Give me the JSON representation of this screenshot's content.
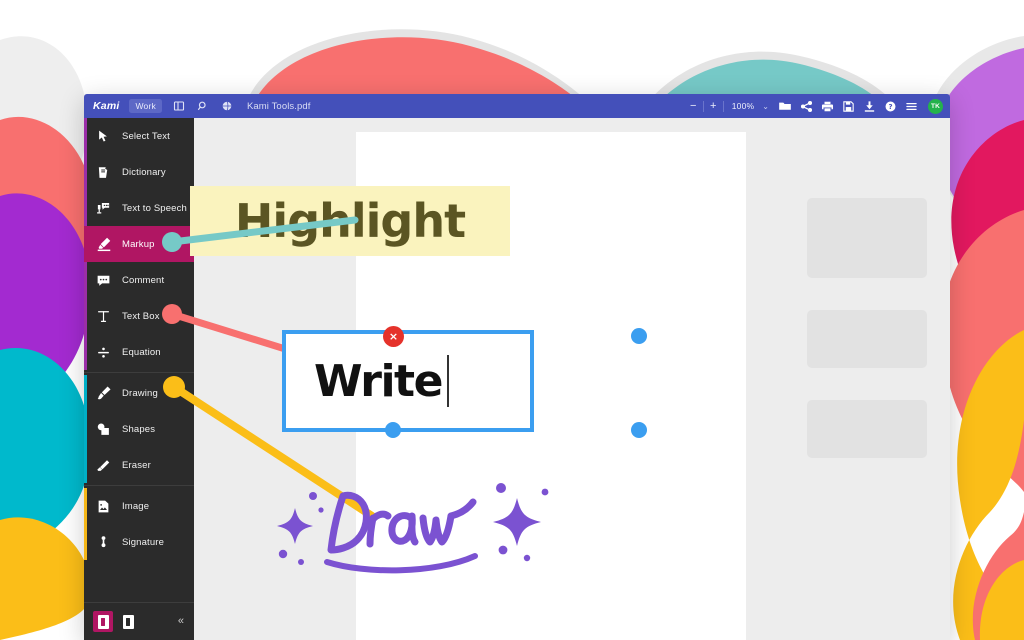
{
  "window": {
    "brand": "Kami",
    "work_badge": "Work",
    "document_title": "Kami Tools.pdf",
    "zoom_level": "100%",
    "zoom_out": "−",
    "zoom_in": "+",
    "avatar_initials": "TK"
  },
  "titlebar_icons": [
    {
      "name": "split-view-icon",
      "label": "Split View"
    },
    {
      "name": "search-icon",
      "label": "Search"
    },
    {
      "name": "globe-icon",
      "label": "Translate"
    }
  ],
  "titlebar_right_icons": [
    {
      "name": "open-folder-icon",
      "label": "Open"
    },
    {
      "name": "share-icon",
      "label": "Share"
    },
    {
      "name": "print-icon",
      "label": "Print"
    },
    {
      "name": "save-icon",
      "label": "Save"
    },
    {
      "name": "download-icon",
      "label": "Download"
    },
    {
      "name": "help-icon",
      "label": "Help"
    },
    {
      "name": "menu-icon",
      "label": "Menu"
    }
  ],
  "sidebar": {
    "groups": [
      {
        "accent": "#9b2ea8",
        "items": [
          {
            "label": "Select Text",
            "icon": "cursor-arrow-icon",
            "active": false
          },
          {
            "label": "Dictionary",
            "icon": "book-icon",
            "active": false
          },
          {
            "label": "Text to Speech",
            "icon": "speech-icon",
            "active": false
          },
          {
            "label": "Markup",
            "icon": "marker-pen-icon",
            "active": true
          },
          {
            "label": "Comment",
            "icon": "comment-bubble-icon",
            "active": false
          },
          {
            "label": "Text Box",
            "icon": "text-box-icon",
            "active": false
          },
          {
            "label": "Equation",
            "icon": "equation-icon",
            "active": false
          }
        ]
      },
      {
        "accent": "#00b0c7",
        "items": [
          {
            "label": "Drawing",
            "icon": "paintbrush-icon",
            "active": false
          },
          {
            "label": "Shapes",
            "icon": "shapes-icon",
            "active": false
          },
          {
            "label": "Eraser",
            "icon": "eraser-icon",
            "active": false
          }
        ]
      },
      {
        "accent": "#f5b719",
        "items": [
          {
            "label": "Image",
            "icon": "image-icon",
            "active": false
          },
          {
            "label": "Signature",
            "icon": "signature-icon",
            "active": false
          }
        ]
      }
    ],
    "bottom": {
      "page_single_icon": "single-page-view-icon",
      "page_double_icon": "double-page-view-icon",
      "collapse_icon": "collapse-sidebar-icon",
      "collapse_glyph": "«"
    }
  },
  "document": {
    "highlight_text": "Highlight",
    "write_text": "Write",
    "draw_text": "Draw",
    "delete_glyph": "×"
  },
  "colors": {
    "titlebar": "#4450ba",
    "sidebar": "#2b2b2b",
    "active_tool": "#b01663",
    "highlight_bg": "#faf3be",
    "highlight_fg": "#5b5523",
    "textbox_border": "#3b9ef0",
    "delete_button": "#e5322b",
    "draw_ink": "#7b52d1",
    "avatar": "#24b24c",
    "pin_markup": "#76c9c7",
    "pin_textbox": "#f8706f",
    "pin_drawing": "#fbbe18"
  },
  "connectors": [
    {
      "name": "markup-to-highlight",
      "color": "#76c9c7"
    },
    {
      "name": "textbox-to-write",
      "color": "#f8706f"
    },
    {
      "name": "drawing-to-draw",
      "color": "#fbbe18"
    }
  ]
}
